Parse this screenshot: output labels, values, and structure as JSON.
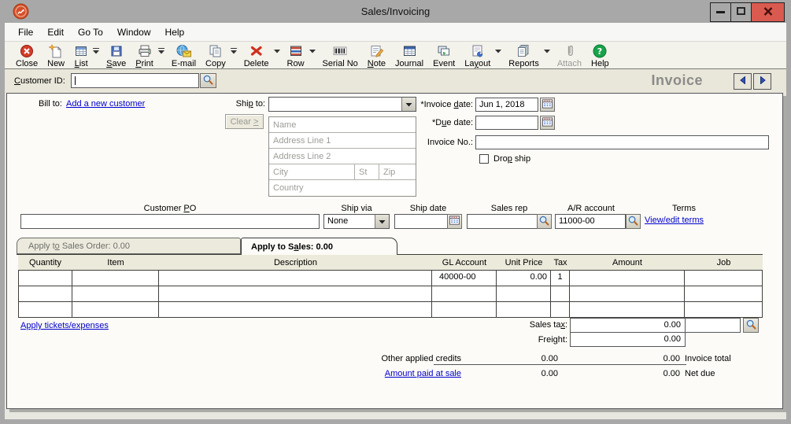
{
  "colors": {
    "link_blue": "#0000cc",
    "close_red": "#da5a50",
    "help_green": "#17a34a",
    "titlebar_gray": "#a8a8a8",
    "panel_bg": "#fcfbf7",
    "strip_bg": "#e9e6da",
    "accent_blue": "#3350b8"
  },
  "window": {
    "title": "Sales/Invoicing"
  },
  "menu": {
    "items": [
      "File",
      "Edit",
      "Go To",
      "Window",
      "Help"
    ]
  },
  "toolbar": {
    "buttons": [
      {
        "icon": "close-icon",
        "pre": "Close",
        "key": "",
        "post": "",
        "dropdown": false
      },
      {
        "icon": "new-icon",
        "pre": "New",
        "key": "",
        "post": "",
        "dropdown": false
      },
      {
        "icon": "list-icon",
        "pre": "",
        "key": "L",
        "post": "ist",
        "dropdown": true
      },
      {
        "icon": "save-icon",
        "pre": "",
        "key": "S",
        "post": "ave",
        "dropdown": false
      },
      {
        "icon": "print-icon",
        "pre": "",
        "key": "P",
        "post": "rint",
        "dropdown": true
      },
      {
        "icon": "email-icon",
        "pre": "E-mail",
        "key": "",
        "post": "",
        "dropdown": false
      },
      {
        "icon": "copy-icon",
        "pre": "Copy",
        "key": "",
        "post": "",
        "dropdown": true
      },
      {
        "icon": "delete-icon",
        "pre": "Delete",
        "key": "",
        "post": "",
        "dropdown": true
      },
      {
        "icon": "row-icon",
        "pre": "Row",
        "key": "",
        "post": "",
        "dropdown": true
      },
      {
        "icon": "serial-no-icon",
        "pre": "Serial No",
        "key": "",
        "post": "",
        "dropdown": false
      },
      {
        "icon": "note-icon",
        "pre": "",
        "key": "N",
        "post": "ote",
        "dropdown": false
      },
      {
        "icon": "journal-icon",
        "pre": "Journal",
        "key": "",
        "post": "",
        "dropdown": false
      },
      {
        "icon": "event-icon",
        "pre": "Event",
        "key": "",
        "post": "",
        "dropdown": false
      },
      {
        "icon": "layout-icon",
        "pre": "La",
        "key": "y",
        "post": "out",
        "dropdown": true
      },
      {
        "icon": "reports-icon",
        "pre": "Reports",
        "key": "",
        "post": "",
        "dropdown": true
      },
      {
        "icon": "attach-icon",
        "pre": "Attach",
        "key": "",
        "post": "",
        "dropdown": false,
        "disabled": true
      },
      {
        "icon": "help-icon",
        "pre": "Help",
        "key": "",
        "post": "",
        "dropdown": false
      }
    ]
  },
  "custbar": {
    "label": {
      "pre": "",
      "key": "C",
      "post": "ustomer ID:"
    },
    "value": "",
    "form_name": "Invoice"
  },
  "billto": {
    "label": "Bill to:",
    "link": "Add a new customer"
  },
  "shipto": {
    "label": {
      "pre": "Shi",
      "key": "p",
      "post": " to:"
    },
    "selected": "",
    "clear": {
      "pre": "Clear ",
      "key": ">",
      "post": ""
    },
    "name": "Name",
    "address1": "Address Line 1",
    "address2": "Address Line 2",
    "city": "City",
    "state": "St",
    "zip": "Zip",
    "country": "Country"
  },
  "invoice": {
    "date_label": {
      "pre": "*Invoice ",
      "key": "d",
      "post": "ate:"
    },
    "date_value": "Jun 1, 2018",
    "due_label": {
      "pre": "*D",
      "key": "u",
      "post": "e date:"
    },
    "due_value": "",
    "no_label": "Invoice No.:",
    "no_value": "",
    "dropship": {
      "pre": "Dro",
      "key": "p",
      "post": " ship",
      "checked": false
    }
  },
  "order": {
    "po_label": {
      "pre": "Customer ",
      "key": "P",
      "post": "O"
    },
    "po_value": "",
    "shipvia_label": "Ship via",
    "shipvia_value": "None",
    "shipdate_label": "Ship date",
    "shipdate_value": "",
    "salesrep_label": "Sales rep",
    "salesrep_value": "",
    "ar_label": "A/R account",
    "ar_value": "11000-00",
    "terms_label": "Terms",
    "terms_link": "View/edit terms"
  },
  "tabs": {
    "sales_order": {
      "pre": "Apply t",
      "key": "o",
      "post": " Sales Order: 0.00"
    },
    "sales": {
      "pre": "Apply to S",
      "key": "a",
      "post": "les: 0.00"
    }
  },
  "table": {
    "headers": [
      "Quantity",
      "Item",
      "Description",
      "GL Account",
      "Unit Price",
      "Tax",
      "Amount",
      "Job"
    ],
    "rows": [
      [
        "",
        "",
        "",
        "40000-00",
        "0.00",
        "1",
        "",
        ""
      ],
      [
        "",
        "",
        "",
        "",
        "",
        "",
        "",
        ""
      ],
      [
        "",
        "",
        "",
        "",
        "",
        "",
        "",
        ""
      ]
    ]
  },
  "footer": {
    "tickets_link": "Apply tickets/expenses",
    "salestax_label": {
      "pre": "Sales ta",
      "key": "x",
      "post": ":"
    },
    "salestax_value": "0.00",
    "freight_label": {
      "pre": "Frei",
      "key": "g",
      "post": "ht:"
    },
    "freight_value": "0.00",
    "credits_label": "Other applied credits",
    "credits_value": "0.00",
    "invoice_total_value": "0.00",
    "invoice_total_label": "Invoice total",
    "paid_link": "Amount paid at sale",
    "paid_value": "0.00",
    "netdue_value": "0.00",
    "netdue_label": "Net due"
  }
}
